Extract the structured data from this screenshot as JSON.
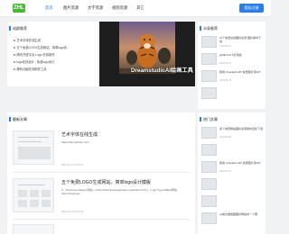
{
  "header": {
    "logo_text": "ZHL",
    "nav": [
      "首页",
      "图片资源",
      "文字资源",
      "视频资源",
      "其它"
    ],
    "login_label": "登陆/注册"
  },
  "recommend": {
    "title": "站群推荐",
    "items": [
      "艺术字体在线生成",
      "五个免费LOGO生成网站，简单logo设...",
      "腾讯开放平台 Logo 在线制作",
      "logo在线设计 - 免费logo设计",
      "哪吒动画在线制作工具"
    ]
  },
  "banner": {
    "caption": "DreamstudioAI绘画工具"
  },
  "side_top": {
    "title": "头条推荐",
    "items": [
      {
        "text": "11个免费在线图标资源 图标素材下载",
        "date": "2022-06-16"
      },
      {
        "text": "gitlab13.2.0汉化版",
        "date": "2022-06-16"
      },
      {
        "text": "使用 Unsplash API 免费图片源API",
        "date": "2022-06-16"
      },
      {
        "text": "",
        "date": ""
      }
    ]
  },
  "latest": {
    "title": "最新文章",
    "posts": [
      {
        "title": "艺术字体在线生成",
        "desc": "https://font.chinaz.com/",
        "date": "2022-06-17 15:05:01"
      },
      {
        "title": "五个免费LOGO生成网站，简单logo设计模版",
        "desc": "1、FreeLogo Design 网站：https://www.freelogodesign.org/index.html 2、Logo Type Maker网站：https://logotype...",
        "date": "2022-06-16 23:00:33"
      }
    ]
  },
  "side_hot": {
    "title": "热门文章",
    "items": [
      {
        "text": "多个免费网站图标资源素材合集下载",
        "date": "2022-06-16"
      },
      {
        "text": "",
        "date": ""
      },
      {
        "text": "使用 Unsplash API 免费图片源API",
        "date": "2022-06-16"
      },
      {
        "text": "",
        "date": ""
      },
      {
        "text": "",
        "date": ""
      },
      {
        "text": "以前文章截图图标网站中一个哪",
        "date": ""
      }
    ]
  }
}
